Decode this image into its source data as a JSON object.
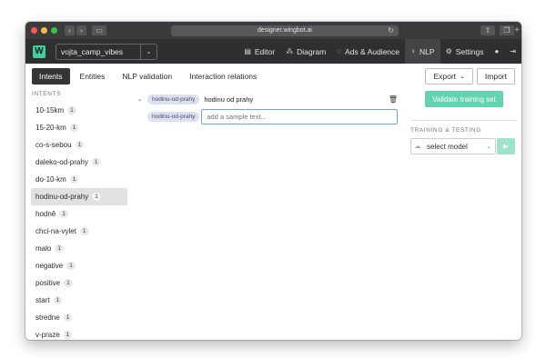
{
  "browser": {
    "url": "designer.wingbot.ai",
    "reload_glyph": "↻"
  },
  "app": {
    "logo_letter": "W",
    "project_name": "vojta_camp_vibes",
    "nav": [
      {
        "label": "Editor",
        "icon": "editor-icon",
        "glyph": "▤"
      },
      {
        "label": "Diagram",
        "icon": "diagram-icon",
        "glyph": "⁂"
      },
      {
        "label": "Ads & Audience",
        "icon": "chat-icon",
        "glyph": "◌"
      },
      {
        "label": "NLP",
        "icon": "bulb-icon",
        "glyph": "♀"
      },
      {
        "label": "Settings",
        "icon": "gear-icon",
        "glyph": "⚙"
      }
    ],
    "user_glyph": "●",
    "logout_glyph": "⇥"
  },
  "tabs": {
    "intents": "Intents",
    "entities": "Entities",
    "nlp_validation": "NLP validation",
    "interaction_relations": "Interaction relations",
    "export": "Export",
    "import": "Import"
  },
  "sidebar": {
    "title": "INTENTS",
    "items": [
      {
        "label": "10-15km",
        "count": "1"
      },
      {
        "label": "15-20-km",
        "count": "1"
      },
      {
        "label": "co-s-sebou",
        "count": "1"
      },
      {
        "label": "daleko-od-prahy",
        "count": "1"
      },
      {
        "label": "do-10-km",
        "count": "1"
      },
      {
        "label": "hodinu-od-prahy",
        "count": "1"
      },
      {
        "label": "hodně",
        "count": "1"
      },
      {
        "label": "chci-na-vylet",
        "count": "1"
      },
      {
        "label": "malo",
        "count": "1"
      },
      {
        "label": "negative",
        "count": "1"
      },
      {
        "label": "positive",
        "count": "1"
      },
      {
        "label": "start",
        "count": "1"
      },
      {
        "label": "stredne",
        "count": "1"
      },
      {
        "label": "v-praze",
        "count": "1"
      }
    ],
    "selected": "hodinu-od-prahy"
  },
  "samples": {
    "intent_tag": "hodinu-od-prahy",
    "sample_text": "hodinu od prahy",
    "new_tag": "hodinu-od-prahy",
    "placeholder": "add a sample text..."
  },
  "right_panel": {
    "validate_label": "Validate training set",
    "section_title": "TRAINING & TESTING",
    "model_placeholder": "select model"
  },
  "colors": {
    "accent": "#63d3b0",
    "dark_nav": "#2f2f31"
  }
}
